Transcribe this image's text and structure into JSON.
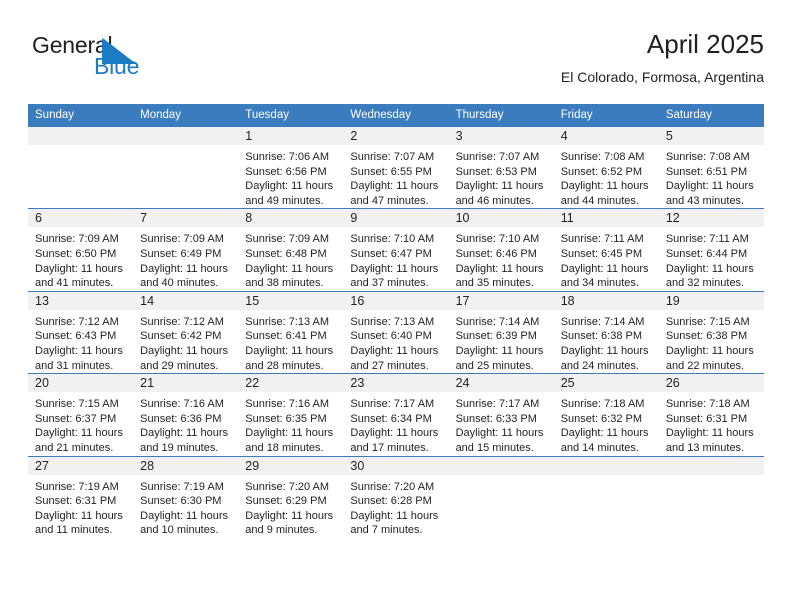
{
  "brand": {
    "name_top": "General",
    "name_bottom": "Blue",
    "triangle_color": "#1b7cc4",
    "text_color": "#231f20",
    "blue_text_color": "#1b7cc4"
  },
  "header": {
    "title": "April 2025",
    "subtitle": "El Colorado, Formosa, Argentina"
  },
  "theme": {
    "header_blue": "#3a7cbe",
    "daynum_band": "#f1f1f1",
    "text": "#231f20"
  },
  "weekdays": [
    "Sunday",
    "Monday",
    "Tuesday",
    "Wednesday",
    "Thursday",
    "Friday",
    "Saturday"
  ],
  "weeks": [
    [
      {
        "day": "",
        "sunrise": "",
        "sunset": "",
        "daylight_line1": "",
        "daylight_line2": ""
      },
      {
        "day": "",
        "sunrise": "",
        "sunset": "",
        "daylight_line1": "",
        "daylight_line2": ""
      },
      {
        "day": "1",
        "sunrise": "Sunrise: 7:06 AM",
        "sunset": "Sunset: 6:56 PM",
        "daylight_line1": "Daylight: 11 hours",
        "daylight_line2": "and 49 minutes."
      },
      {
        "day": "2",
        "sunrise": "Sunrise: 7:07 AM",
        "sunset": "Sunset: 6:55 PM",
        "daylight_line1": "Daylight: 11 hours",
        "daylight_line2": "and 47 minutes."
      },
      {
        "day": "3",
        "sunrise": "Sunrise: 7:07 AM",
        "sunset": "Sunset: 6:53 PM",
        "daylight_line1": "Daylight: 11 hours",
        "daylight_line2": "and 46 minutes."
      },
      {
        "day": "4",
        "sunrise": "Sunrise: 7:08 AM",
        "sunset": "Sunset: 6:52 PM",
        "daylight_line1": "Daylight: 11 hours",
        "daylight_line2": "and 44 minutes."
      },
      {
        "day": "5",
        "sunrise": "Sunrise: 7:08 AM",
        "sunset": "Sunset: 6:51 PM",
        "daylight_line1": "Daylight: 11 hours",
        "daylight_line2": "and 43 minutes."
      }
    ],
    [
      {
        "day": "6",
        "sunrise": "Sunrise: 7:09 AM",
        "sunset": "Sunset: 6:50 PM",
        "daylight_line1": "Daylight: 11 hours",
        "daylight_line2": "and 41 minutes."
      },
      {
        "day": "7",
        "sunrise": "Sunrise: 7:09 AM",
        "sunset": "Sunset: 6:49 PM",
        "daylight_line1": "Daylight: 11 hours",
        "daylight_line2": "and 40 minutes."
      },
      {
        "day": "8",
        "sunrise": "Sunrise: 7:09 AM",
        "sunset": "Sunset: 6:48 PM",
        "daylight_line1": "Daylight: 11 hours",
        "daylight_line2": "and 38 minutes."
      },
      {
        "day": "9",
        "sunrise": "Sunrise: 7:10 AM",
        "sunset": "Sunset: 6:47 PM",
        "daylight_line1": "Daylight: 11 hours",
        "daylight_line2": "and 37 minutes."
      },
      {
        "day": "10",
        "sunrise": "Sunrise: 7:10 AM",
        "sunset": "Sunset: 6:46 PM",
        "daylight_line1": "Daylight: 11 hours",
        "daylight_line2": "and 35 minutes."
      },
      {
        "day": "11",
        "sunrise": "Sunrise: 7:11 AM",
        "sunset": "Sunset: 6:45 PM",
        "daylight_line1": "Daylight: 11 hours",
        "daylight_line2": "and 34 minutes."
      },
      {
        "day": "12",
        "sunrise": "Sunrise: 7:11 AM",
        "sunset": "Sunset: 6:44 PM",
        "daylight_line1": "Daylight: 11 hours",
        "daylight_line2": "and 32 minutes."
      }
    ],
    [
      {
        "day": "13",
        "sunrise": "Sunrise: 7:12 AM",
        "sunset": "Sunset: 6:43 PM",
        "daylight_line1": "Daylight: 11 hours",
        "daylight_line2": "and 31 minutes."
      },
      {
        "day": "14",
        "sunrise": "Sunrise: 7:12 AM",
        "sunset": "Sunset: 6:42 PM",
        "daylight_line1": "Daylight: 11 hours",
        "daylight_line2": "and 29 minutes."
      },
      {
        "day": "15",
        "sunrise": "Sunrise: 7:13 AM",
        "sunset": "Sunset: 6:41 PM",
        "daylight_line1": "Daylight: 11 hours",
        "daylight_line2": "and 28 minutes."
      },
      {
        "day": "16",
        "sunrise": "Sunrise: 7:13 AM",
        "sunset": "Sunset: 6:40 PM",
        "daylight_line1": "Daylight: 11 hours",
        "daylight_line2": "and 27 minutes."
      },
      {
        "day": "17",
        "sunrise": "Sunrise: 7:14 AM",
        "sunset": "Sunset: 6:39 PM",
        "daylight_line1": "Daylight: 11 hours",
        "daylight_line2": "and 25 minutes."
      },
      {
        "day": "18",
        "sunrise": "Sunrise: 7:14 AM",
        "sunset": "Sunset: 6:38 PM",
        "daylight_line1": "Daylight: 11 hours",
        "daylight_line2": "and 24 minutes."
      },
      {
        "day": "19",
        "sunrise": "Sunrise: 7:15 AM",
        "sunset": "Sunset: 6:38 PM",
        "daylight_line1": "Daylight: 11 hours",
        "daylight_line2": "and 22 minutes."
      }
    ],
    [
      {
        "day": "20",
        "sunrise": "Sunrise: 7:15 AM",
        "sunset": "Sunset: 6:37 PM",
        "daylight_line1": "Daylight: 11 hours",
        "daylight_line2": "and 21 minutes."
      },
      {
        "day": "21",
        "sunrise": "Sunrise: 7:16 AM",
        "sunset": "Sunset: 6:36 PM",
        "daylight_line1": "Daylight: 11 hours",
        "daylight_line2": "and 19 minutes."
      },
      {
        "day": "22",
        "sunrise": "Sunrise: 7:16 AM",
        "sunset": "Sunset: 6:35 PM",
        "daylight_line1": "Daylight: 11 hours",
        "daylight_line2": "and 18 minutes."
      },
      {
        "day": "23",
        "sunrise": "Sunrise: 7:17 AM",
        "sunset": "Sunset: 6:34 PM",
        "daylight_line1": "Daylight: 11 hours",
        "daylight_line2": "and 17 minutes."
      },
      {
        "day": "24",
        "sunrise": "Sunrise: 7:17 AM",
        "sunset": "Sunset: 6:33 PM",
        "daylight_line1": "Daylight: 11 hours",
        "daylight_line2": "and 15 minutes."
      },
      {
        "day": "25",
        "sunrise": "Sunrise: 7:18 AM",
        "sunset": "Sunset: 6:32 PM",
        "daylight_line1": "Daylight: 11 hours",
        "daylight_line2": "and 14 minutes."
      },
      {
        "day": "26",
        "sunrise": "Sunrise: 7:18 AM",
        "sunset": "Sunset: 6:31 PM",
        "daylight_line1": "Daylight: 11 hours",
        "daylight_line2": "and 13 minutes."
      }
    ],
    [
      {
        "day": "27",
        "sunrise": "Sunrise: 7:19 AM",
        "sunset": "Sunset: 6:31 PM",
        "daylight_line1": "Daylight: 11 hours",
        "daylight_line2": "and 11 minutes."
      },
      {
        "day": "28",
        "sunrise": "Sunrise: 7:19 AM",
        "sunset": "Sunset: 6:30 PM",
        "daylight_line1": "Daylight: 11 hours",
        "daylight_line2": "and 10 minutes."
      },
      {
        "day": "29",
        "sunrise": "Sunrise: 7:20 AM",
        "sunset": "Sunset: 6:29 PM",
        "daylight_line1": "Daylight: 11 hours",
        "daylight_line2": "and 9 minutes."
      },
      {
        "day": "30",
        "sunrise": "Sunrise: 7:20 AM",
        "sunset": "Sunset: 6:28 PM",
        "daylight_line1": "Daylight: 11 hours",
        "daylight_line2": "and 7 minutes."
      },
      {
        "day": "",
        "sunrise": "",
        "sunset": "",
        "daylight_line1": "",
        "daylight_line2": ""
      },
      {
        "day": "",
        "sunrise": "",
        "sunset": "",
        "daylight_line1": "",
        "daylight_line2": ""
      },
      {
        "day": "",
        "sunrise": "",
        "sunset": "",
        "daylight_line1": "",
        "daylight_line2": ""
      }
    ]
  ]
}
